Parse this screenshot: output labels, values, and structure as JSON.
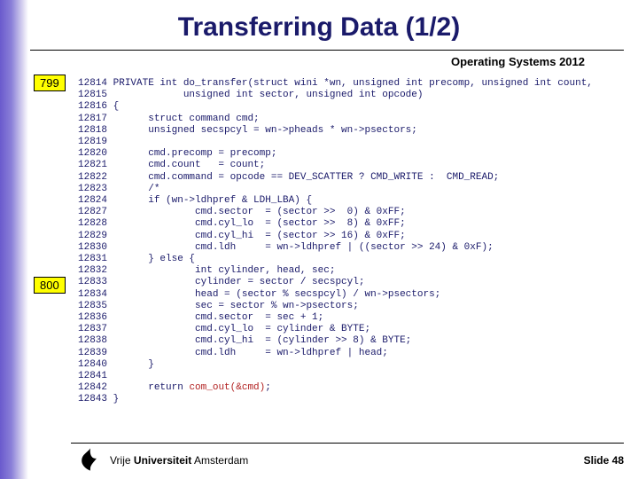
{
  "title": "Transferring Data (1/2)",
  "subhead": "Operating Systems 2012",
  "tags": {
    "t1": "799",
    "t2": "800"
  },
  "code": {
    "lines": [
      {
        "n": "12814",
        "t": "PRIVATE int do_transfer(struct wini *wn, unsigned int precomp, unsigned int count,"
      },
      {
        "n": "12815",
        "t": "            unsigned int sector, unsigned int opcode)"
      },
      {
        "n": "12816",
        "t": "{"
      },
      {
        "n": "12817",
        "t": "      struct command cmd;"
      },
      {
        "n": "12818",
        "t": "      unsigned secspcyl = wn->pheads * wn->psectors;"
      },
      {
        "n": "12819",
        "t": ""
      },
      {
        "n": "12820",
        "t": "      cmd.precomp = precomp;"
      },
      {
        "n": "12821",
        "t": "      cmd.count   = count;"
      },
      {
        "n": "12822",
        "t": "      cmd.command = opcode == DEV_SCATTER ? CMD_WRITE :  CMD_READ;"
      },
      {
        "n": "12823",
        "t": "      /*"
      },
      {
        "n": "12824",
        "t": "      if (wn->ldhpref & LDH_LBA) {"
      },
      {
        "n": "12827",
        "t": "              cmd.sector  = (sector >>  0) & 0xFF;"
      },
      {
        "n": "12828",
        "t": "              cmd.cyl_lo  = (sector >>  8) & 0xFF;"
      },
      {
        "n": "12829",
        "t": "              cmd.cyl_hi  = (sector >> 16) & 0xFF;"
      },
      {
        "n": "12830",
        "t": "              cmd.ldh     = wn->ldhpref | ((sector >> 24) & 0xF);"
      },
      {
        "n": "12831",
        "t": "      } else {"
      },
      {
        "n": "12832",
        "t": "              int cylinder, head, sec;"
      },
      {
        "n": "12833",
        "t": "              cylinder = sector / secspcyl;"
      },
      {
        "n": "12834",
        "t": "              head = (sector % secspcyl) / wn->psectors;"
      },
      {
        "n": "12835",
        "t": "              sec = sector % wn->psectors;"
      },
      {
        "n": "12836",
        "t": "              cmd.sector  = sec + 1;"
      },
      {
        "n": "12837",
        "t": "              cmd.cyl_lo  = cylinder & BYTE;"
      },
      {
        "n": "12838",
        "t": "              cmd.cyl_hi  = (cylinder >> 8) & BYTE;"
      },
      {
        "n": "12839",
        "t": "              cmd.ldh     = wn->ldhpref | head;"
      },
      {
        "n": "12840",
        "t": "      }"
      },
      {
        "n": "12841",
        "t": ""
      },
      {
        "n": "12842",
        "t": "      return ",
        "call": "com_out(&cmd)",
        "tail": ";"
      },
      {
        "n": "12843",
        "t": "}"
      }
    ]
  },
  "footer": {
    "uni_prefix": "Vrije ",
    "uni_bold": "Universiteit",
    "uni_suffix": " Amsterdam",
    "slide_label": "Slide ",
    "slide_num": "48"
  }
}
